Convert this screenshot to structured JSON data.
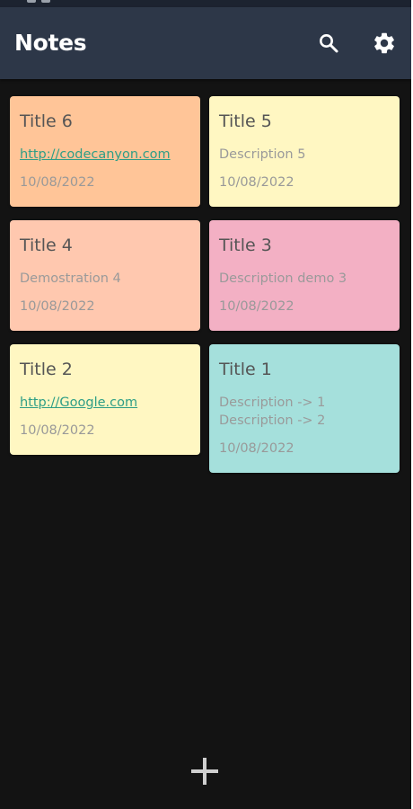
{
  "app_bar": {
    "title": "Notes",
    "background": "#2d3748",
    "actions": [
      {
        "icon": "search-icon"
      },
      {
        "icon": "gear-icon"
      }
    ]
  },
  "notes": [
    {
      "title": "Title 6",
      "description": "http://codecanyon.com",
      "is_link": true,
      "date": "10/08/2022",
      "color": "#ffc598"
    },
    {
      "title": "Title 5",
      "description": "Description 5",
      "is_link": false,
      "date": "10/08/2022",
      "color": "#fff7c2"
    },
    {
      "title": "Title 4",
      "description": "Demostration 4",
      "is_link": false,
      "date": "10/08/2022",
      "color": "#ffc8af"
    },
    {
      "title": "Title 3",
      "description": "Description demo 3",
      "is_link": false,
      "date": "10/08/2022",
      "color": "#f3b0c4"
    },
    {
      "title": "Title 2",
      "description": "http://Google.com",
      "is_link": true,
      "date": "10/08/2022",
      "color": "#fff7c2"
    },
    {
      "title": "Title 1",
      "description": "Description -> 1",
      "description_line2": "Description -> 2",
      "is_link": false,
      "date": "10/08/2022",
      "color": "#a5e0dc"
    }
  ],
  "fab": {
    "icon": "plus-icon"
  },
  "theme": {
    "background": "#131313",
    "link_color": "#2e9e86"
  }
}
